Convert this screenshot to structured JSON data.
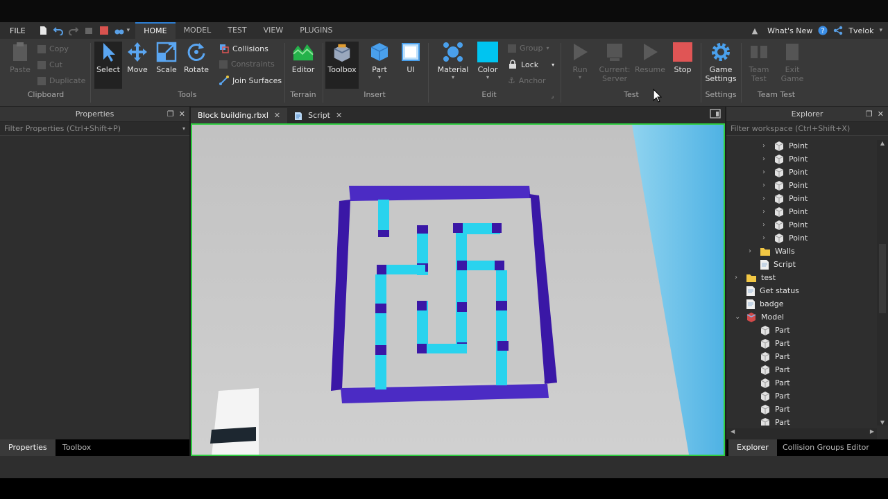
{
  "menu": {
    "file": "FILE",
    "tabs": [
      "HOME",
      "MODEL",
      "TEST",
      "VIEW",
      "PLUGINS"
    ],
    "active_tab": "HOME",
    "whats_new": "What's New",
    "user": "Tvelok"
  },
  "ribbon": {
    "clipboard": {
      "paste": "Paste",
      "copy": "Copy",
      "cut": "Cut",
      "duplicate": "Duplicate",
      "label": "Clipboard"
    },
    "tools": {
      "select": "Select",
      "move": "Move",
      "scale": "Scale",
      "rotate": "Rotate",
      "collisions": "Collisions",
      "constraints": "Constraints",
      "join_surfaces": "Join Surfaces",
      "label": "Tools"
    },
    "terrain": {
      "editor": "Editor",
      "label": "Terrain"
    },
    "insert": {
      "toolbox": "Toolbox",
      "part": "Part",
      "ui": "UI",
      "label": "Insert"
    },
    "edit": {
      "material": "Material",
      "color": "Color",
      "group": "Group",
      "lock": "Lock",
      "anchor": "Anchor",
      "label": "Edit"
    },
    "test": {
      "run": "Run",
      "current_server_1": "Current:",
      "current_server_2": "Server",
      "resume": "Resume",
      "stop": "Stop",
      "label": "Test"
    },
    "settings": {
      "game_settings_1": "Game",
      "game_settings_2": "Settings",
      "label": "Settings"
    },
    "team_test": {
      "team_test_1": "Team",
      "team_test_2": "Test",
      "exit_game_1": "Exit",
      "exit_game_2": "Game",
      "label": "Team Test"
    }
  },
  "properties": {
    "title": "Properties",
    "filter_placeholder": "Filter Properties (Ctrl+Shift+P)"
  },
  "doc_tabs": [
    "Block building.rbxl",
    "Script"
  ],
  "explorer": {
    "title": "Explorer",
    "filter_placeholder": "Filter workspace (Ctrl+Shift+X)",
    "items": [
      {
        "label": "Point",
        "kind": "part",
        "indent": 1
      },
      {
        "label": "Point",
        "kind": "part",
        "indent": 1
      },
      {
        "label": "Point",
        "kind": "part",
        "indent": 1
      },
      {
        "label": "Point",
        "kind": "part",
        "indent": 1
      },
      {
        "label": "Point",
        "kind": "part",
        "indent": 1
      },
      {
        "label": "Point",
        "kind": "part",
        "indent": 1
      },
      {
        "label": "Point",
        "kind": "part",
        "indent": 1
      },
      {
        "label": "Point",
        "kind": "part",
        "indent": 1
      },
      {
        "label": "Walls",
        "kind": "folder",
        "indent": 0
      },
      {
        "label": "Script",
        "kind": "script",
        "indent": 0
      },
      {
        "label": "test",
        "kind": "folder",
        "indent": -1
      },
      {
        "label": "Get status",
        "kind": "script",
        "indent": -1
      },
      {
        "label": "badge",
        "kind": "script",
        "indent": -1
      },
      {
        "label": "Model",
        "kind": "model",
        "indent": -1
      },
      {
        "label": "Part",
        "kind": "part",
        "indent": 0
      },
      {
        "label": "Part",
        "kind": "part",
        "indent": 0
      },
      {
        "label": "Part",
        "kind": "part",
        "indent": 0
      },
      {
        "label": "Part",
        "kind": "part",
        "indent": 0
      },
      {
        "label": "Part",
        "kind": "part",
        "indent": 0
      },
      {
        "label": "Part",
        "kind": "part",
        "indent": 0
      },
      {
        "label": "Part",
        "kind": "part",
        "indent": 0
      },
      {
        "label": "Part",
        "kind": "part",
        "indent": 0
      }
    ]
  },
  "bottom_tabs_left": [
    "Properties",
    "Toolbox"
  ],
  "bottom_tabs_right": [
    "Explorer",
    "Collision Groups Editor"
  ],
  "colors": {
    "accent": "#2d7fd4",
    "viewport_border": "#2ecc40",
    "maze_wall": "#3a17a6",
    "maze_block": "#29d3ee",
    "stop": "#e05555"
  }
}
